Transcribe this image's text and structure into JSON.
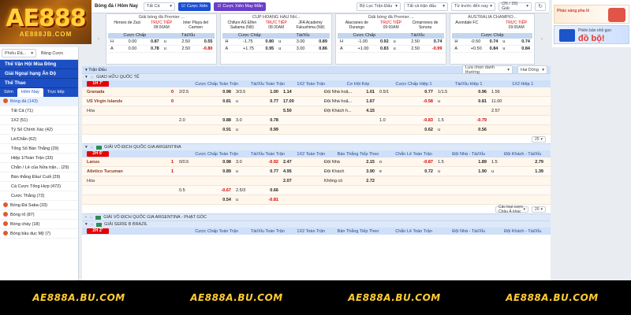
{
  "logo": {
    "big": "AE888",
    "small": "AE888JB.COM"
  },
  "topbar": {
    "crumb": "Bóng đá / Hôm Nay",
    "filter": "Tất Cả",
    "live_btn": "Cược Xiên",
    "mix_btn": "Cược Xiên May Mắn",
    "league_filter": "Bộ Lọc Trận Đấu",
    "all_select": "Tất cả trận đấu",
    "sort": "Từ trước đến nay",
    "pages": "(26 / 26) Giải"
  },
  "cards": [
    {
      "league": "Giải bóng đá Premier ...",
      "home": "Heroes de Zaci",
      "away": "Inter Playa del Carmen",
      "live": "TRỰC TIẾP",
      "time": "08:00AM",
      "hdr1": "Cược Chấp",
      "hdr2": "Tài/Xỉu",
      "r1": [
        "H",
        "0.00",
        "0.87",
        "u",
        "2.50",
        "0.55"
      ],
      "r2": [
        "A",
        "0.00",
        "0.78",
        "u",
        "2.50",
        "-0.80"
      ]
    },
    {
      "league": "CÚP HOÀNG HẬU NH...",
      "home": "Chifure AS Elfen Saitama (Nữ)",
      "away": "JFA Academy Fukushima (Nữ)",
      "live": "TRỰC TIẾP",
      "time": "08:30AM",
      "hdr1": "Cược Chấp",
      "hdr2": "Tài/Xỉu",
      "r1": [
        "H",
        "-1.75",
        "0.80",
        "u",
        "3.00",
        "0.89"
      ],
      "r2": [
        "A",
        "+1.75",
        "0.95",
        "u",
        "3.00",
        "0.86"
      ]
    },
    {
      "league": "Giải bóng đá Premier ...",
      "home": "Alacranes de Durango",
      "away": "Cimarrones de Sonora",
      "live": "TRỰC TIẾP",
      "time": "09:00AM",
      "hdr1": "Cược Chấp",
      "hdr2": "Tài/Xỉu",
      "r1": [
        "H",
        "-1.00",
        "0.92",
        "u",
        "2.50",
        "0.74"
      ],
      "r2": [
        "A",
        "+1.00",
        "0.83",
        "u",
        "2.50",
        "-0.99"
      ]
    },
    {
      "league": "AUSTRALIA CHAMPIO...",
      "home": "Avondale FC",
      "away": "",
      "live": "TRỰC TIẾP",
      "time": "09:00AM",
      "hdr1": "Cược Chấp",
      "hdr2": "",
      "r1": [
        "H",
        "-0.50",
        "0.74",
        "u",
        "",
        "0.74"
      ],
      "r2": [
        "A",
        "+0.50",
        "0.84",
        "u",
        "",
        "0.84"
      ]
    }
  ],
  "ad": {
    "a1": "Pháo sáng pha lê",
    "a2_small": "Phiên bản nhỏ gọn",
    "a2_big": "đồ bộ!"
  },
  "sidebar": {
    "select": "Phiếu Đặ...",
    "plain": "Bảng Cược",
    "sec1": "Thể Vận Hội Mùa Đông",
    "sec2": "Giải Ngoại hạng Ấn Độ",
    "sec3": "Thể Thao",
    "tabs": [
      "Sớm",
      "Hôm Nay",
      "Trực tiếp"
    ],
    "items": [
      {
        "label": "Bóng đá (143)",
        "sub": false,
        "icon": true,
        "active": true
      },
      {
        "label": "Tất Cả (71)",
        "sub": true,
        "icon": false,
        "active": false
      },
      {
        "label": "1X2 (51)",
        "sub": true,
        "icon": false,
        "active": false
      },
      {
        "label": "Tỷ Số Chính Xác (42)",
        "sub": true,
        "icon": false,
        "active": false
      },
      {
        "label": "Lẻ/Chẵn (62)",
        "sub": true,
        "icon": false,
        "active": false
      },
      {
        "label": "Tổng Số Bàn Thắng (29)",
        "sub": true,
        "icon": false,
        "active": false
      },
      {
        "label": "Hiệp 1/Toàn Trận (33)",
        "sub": true,
        "icon": false,
        "active": false
      },
      {
        "label": "Chẵn / Lẻ của Nửa trận... (29)",
        "sub": true,
        "icon": false,
        "active": false
      },
      {
        "label": "Bàn thắng Đầu/ Cuối (29)",
        "sub": true,
        "icon": false,
        "active": false
      },
      {
        "label": "Cá Cược Tổng Hợp (472)",
        "sub": true,
        "icon": false,
        "active": false
      },
      {
        "label": "Cược Thắng (72)",
        "sub": true,
        "icon": false,
        "active": false
      },
      {
        "label": "Bóng Đá Saba (33)",
        "sub": false,
        "icon": true,
        "active": false
      },
      {
        "label": "Bóng rổ (87)",
        "sub": false,
        "icon": true,
        "active": false
      },
      {
        "label": "Bóng chày (18)",
        "sub": false,
        "icon": true,
        "active": false
      },
      {
        "label": "Bóng bầu dục Mỹ (7)",
        "sub": false,
        "icon": true,
        "active": false
      }
    ]
  },
  "main": {
    "header_left": "Trận Đấu",
    "sort_label": "Lựa chọn danh thường",
    "lang": "Hai Dòng",
    "league1": "GIAO HỮU QUỐC TẾ",
    "time1": "1H 7'",
    "cols1": [
      "Cược Chấp Toàn Trận",
      "Tài/Xỉu Toàn Trận",
      "1X2 Toàn Trận",
      "Cơ Hội Kép",
      "Cược Chấp Hiệp 1",
      "Tài/Xỉu Hiệp 1",
      "1X2 Hiệp 1"
    ],
    "m1": {
      "home": "Granada",
      "home_score": "0",
      "away": "US Virgin Islands",
      "away_score": "0",
      "draw": "Hòa",
      "r1": [
        "2/2.5",
        "0.98",
        "3/3.5",
        "1.00",
        "1.14",
        "Đội Nhà hoặ...",
        "1.01",
        "0.5/1",
        "0.77",
        "1/1.5",
        "0.96",
        "1.56"
      ],
      "r2": [
        "",
        "0.81",
        "u",
        "0.77",
        "17.00",
        "Đội Nhà hoặ...",
        "1.67",
        "",
        "-0.58",
        "u",
        "0.81",
        "11.00"
      ],
      "r3": [
        "",
        "",
        "",
        "",
        "5.50",
        "Đội Khách h...",
        "4.15",
        "",
        "",
        "",
        "",
        "2.57"
      ],
      "r4": [
        "2.0",
        "0.88",
        "3.0",
        "0.78",
        "",
        "",
        "",
        "1.0",
        "-0.83",
        "1.5",
        "-0.79",
        ""
      ],
      "r5": [
        "",
        "0.91",
        "u",
        "0.99",
        "",
        "",
        "",
        "",
        "0.62",
        "u",
        "0.56",
        ""
      ]
    },
    "pager1": "25",
    "league2": "GIẢI VÔ ĐỊCH QUỐC GIA ARGENTINA",
    "time2": "2H 6'",
    "cols2": [
      "Cược Chấp Toàn Trận",
      "Tài/Xỉu Toàn Trận",
      "1X2 Toàn Trận",
      "Bàn Thắng Tiếp Theo",
      "Chẵn Lẻ Toàn Trận",
      "Đội Nhà - Tài/Xỉu",
      "Đội Khách - Tài/Xỉu"
    ],
    "m2": {
      "home": "Lanus",
      "home_score": "1",
      "away": "Atletico Tucuman",
      "away_score": "1",
      "draw": "Hòa",
      "r1": [
        "0/0.5",
        "0.98",
        "3.0",
        "-0.92",
        "2.47",
        "Đội Nhà",
        "2.15",
        "o",
        "-0.87",
        "1.5",
        "1.89",
        "1.5",
        "2.79"
      ],
      "r2": [
        "",
        "0.89",
        "u",
        "0.77",
        "4.95",
        "Đội Khách",
        "3.90",
        "e",
        "0.72",
        "u",
        "1.90",
        "u",
        "1.39"
      ],
      "r3": [
        "",
        "",
        "",
        "",
        "2.07",
        "Không có",
        "2.72",
        "",
        "",
        "",
        "",
        "",
        ""
      ],
      "r4": [
        "0.5",
        "-0.67",
        "2.5/3",
        "0.66",
        "",
        "",
        "",
        "",
        "",
        "",
        "",
        "",
        ""
      ],
      "r5": [
        "",
        "0.54",
        "u",
        "-0.81",
        "",
        "",
        "",
        "",
        "",
        "",
        "",
        "",
        ""
      ]
    },
    "pager2_a": "Các loại cược Châu Á khác",
    "pager2_b": "20",
    "league3": "GIẢI VÔ ĐỊCH QUỐC GIA ARGENTINA - PHẠT GÓC",
    "league4": "GIẢI SERIE B BRAZIL",
    "time4": "2H 2'",
    "cols4": [
      "Cược Chấp Toàn Trận",
      "Tài/Xỉu Toàn Trận",
      "1X2 Toàn Trận",
      "Bàn Thắng Tiếp Theo",
      "Chẵn Lẻ Toàn Trận",
      "Đội Nhà - Tài/Xỉu",
      "Đội Khách - Tài/Xỉu"
    ]
  },
  "footer": [
    "AE888A.BU.COM",
    "AE888A.BU.COM",
    "AE888A.BU.COM",
    "AE888A.BU.COM"
  ]
}
